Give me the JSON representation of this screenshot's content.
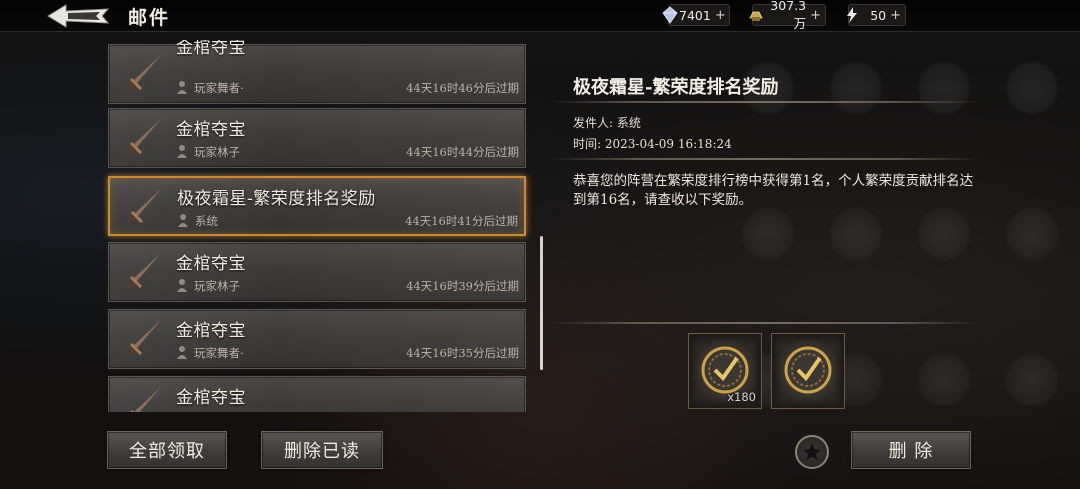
{
  "header": {
    "title": "邮件",
    "currencies": [
      {
        "icon": "diamond-icon",
        "value": "7401"
      },
      {
        "icon": "gold-ingot-icon",
        "value": "307.3万"
      },
      {
        "icon": "lightning-stamina-icon",
        "value": "50"
      }
    ],
    "plus": "+"
  },
  "mail_list": [
    {
      "title": "金棺夺宝",
      "sender": "玩家舞者·",
      "expire": "44天16时46分后过期",
      "selected": false
    },
    {
      "title": "金棺夺宝",
      "sender": "玩家林子",
      "expire": "44天16时44分后过期",
      "selected": false
    },
    {
      "title": "极夜霜星-繁荣度排名奖励",
      "sender": "系统",
      "expire": "44天16时41分后过期",
      "selected": true
    },
    {
      "title": "金棺夺宝",
      "sender": "玩家林子",
      "expire": "44天16时39分后过期",
      "selected": false
    },
    {
      "title": "金棺夺宝",
      "sender": "玩家舞者·",
      "expire": "44天16时35分后过期",
      "selected": false
    },
    {
      "title": "金棺夺宝",
      "sender": "",
      "expire": "",
      "selected": false
    }
  ],
  "detail": {
    "title": "极夜霜星-繁荣度排名奖励",
    "sender_label": "发件人: 系统",
    "time_label": "时间: 2023-04-09 16:18:24",
    "body": "恭喜您的阵营在繁荣度排行榜中获得第1名，个人繁荣度贡献排名达到第16名，请查收以下奖励。",
    "rewards": [
      {
        "icon": "medal-check-icon",
        "quantity": "x180"
      },
      {
        "icon": "medal-check-icon",
        "quantity": ""
      }
    ]
  },
  "buttons": {
    "claim_all": "全部领取",
    "delete_read": "删除已读",
    "delete": "删 除"
  },
  "colors": {
    "selected_border": "#c98a33",
    "item_bg": "#3c3a38"
  }
}
